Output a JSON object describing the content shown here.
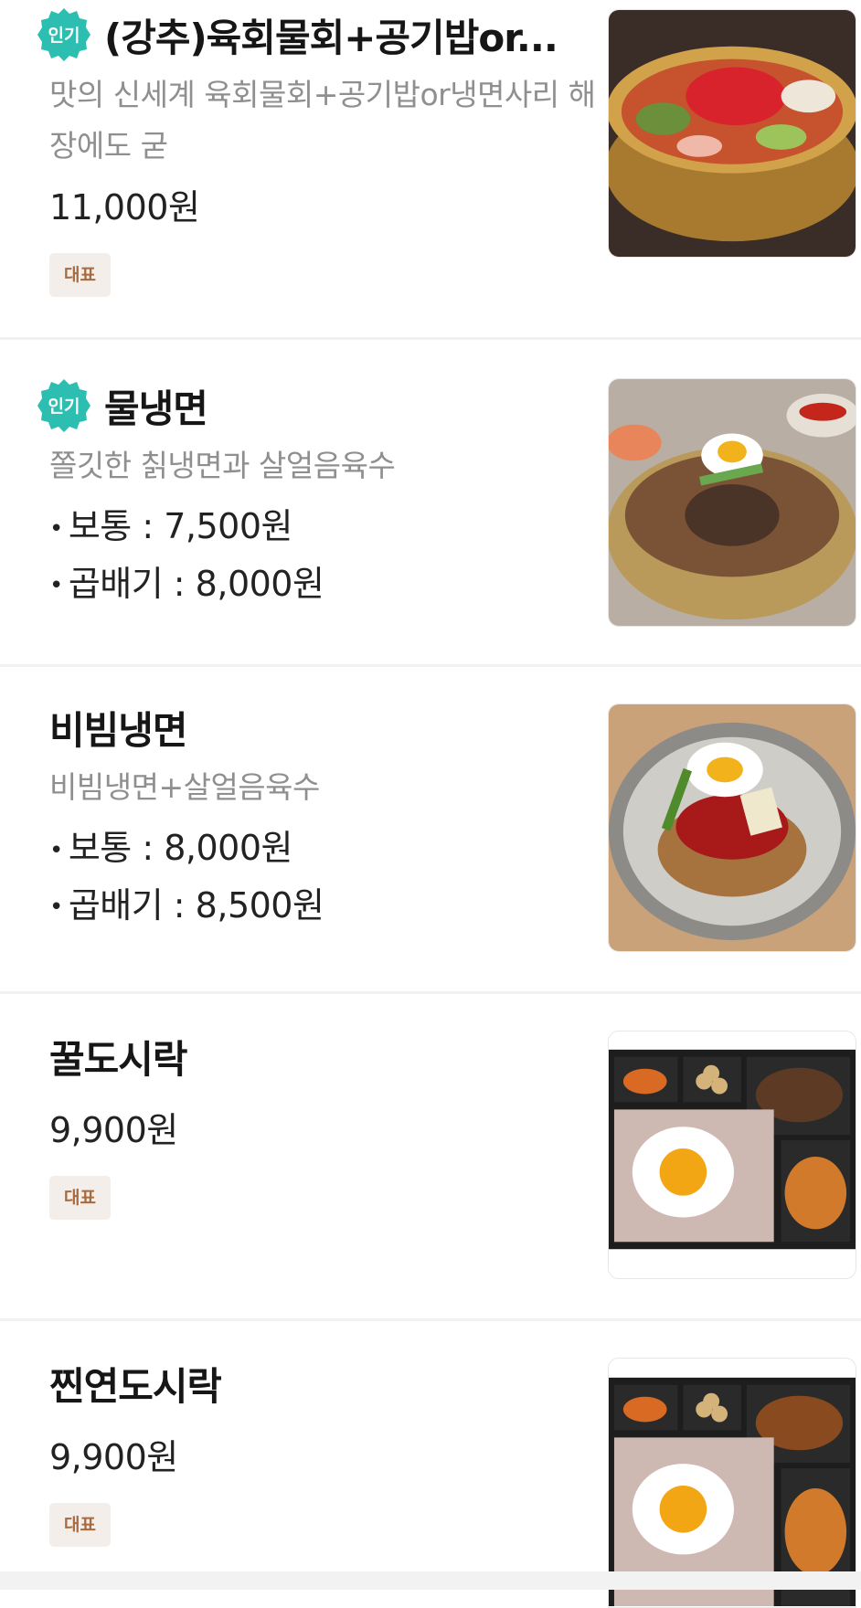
{
  "badges": {
    "popular": "인기",
    "representative": "대표"
  },
  "menu": {
    "items": [
      {
        "name": "(강추)육회물회+공기밥or...",
        "description": "맛의 신세계 육회물회+공기밥or냉면사리 해장에도 굳",
        "price": "11,000원",
        "popular": true,
        "representative": true,
        "photo": "yukhoe-mulhoe-bowl"
      },
      {
        "name": "물냉면",
        "description": "쫄깃한 칡냉면과 살얼음육수",
        "options": [
          "보통 : 7,500원",
          "곱배기 : 8,000원"
        ],
        "popular": true,
        "photo": "mul-naengmyeon-bowl"
      },
      {
        "name": "비빔냉면",
        "description": "비빔냉면+살얼음육수",
        "options": [
          "보통 : 8,000원",
          "곱배기 : 8,500원"
        ],
        "photo": "bibim-naengmyeon-bowl"
      },
      {
        "name": "꿀도시락",
        "price": "9,900원",
        "representative": true,
        "photo": "lunchbox-bulgogi"
      },
      {
        "name": "찐연도시락",
        "price": "9,900원",
        "representative": true,
        "photo": "lunchbox-spicy-pork"
      }
    ]
  },
  "colors": {
    "popular_badge": "#2cbfb1",
    "representative_bg": "#f3eee9",
    "representative_text": "#a86a3f",
    "description_text": "#8f8f8f"
  }
}
